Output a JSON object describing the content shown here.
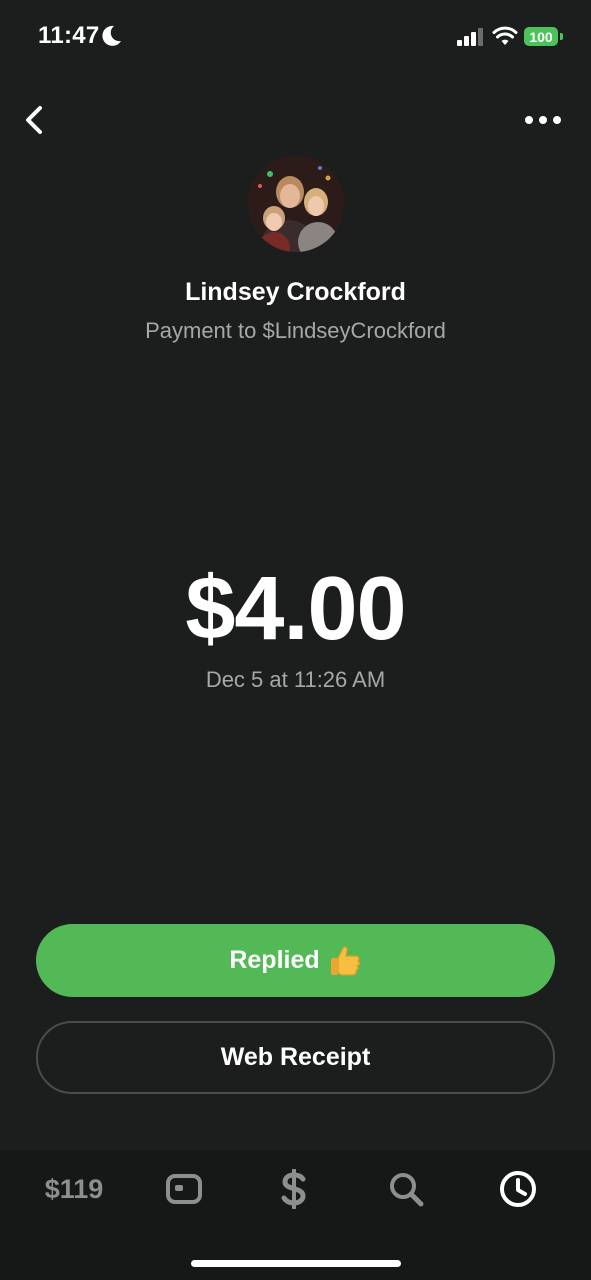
{
  "status_bar": {
    "time": "11:47",
    "battery": "100",
    "icons": [
      "moon-icon",
      "cellular-signal-icon",
      "wifi-icon",
      "battery-icon"
    ]
  },
  "header": {
    "back_icon": "chevron-left-icon",
    "more_icon": "ellipsis-icon"
  },
  "recipient": {
    "name": "Lindsey Crockford",
    "subtitle": "Payment to $LindseyCrockford"
  },
  "payment": {
    "amount": "$4.00",
    "datetime": "Dec 5 at 11:26 AM"
  },
  "actions": {
    "replied_label": "Replied",
    "replied_emoji": "thumbs-up-emoji",
    "web_receipt_label": "Web Receipt"
  },
  "tab_bar": {
    "balance": "$119",
    "tabs": [
      "card-icon",
      "dollar-icon",
      "search-icon",
      "clock-icon"
    ],
    "active_tab": "clock-icon"
  },
  "colors": {
    "background": "#1c1d1d",
    "accent_green": "#53b957",
    "secondary_text": "#a6a8a8",
    "battery_green": "#4cc35a"
  }
}
